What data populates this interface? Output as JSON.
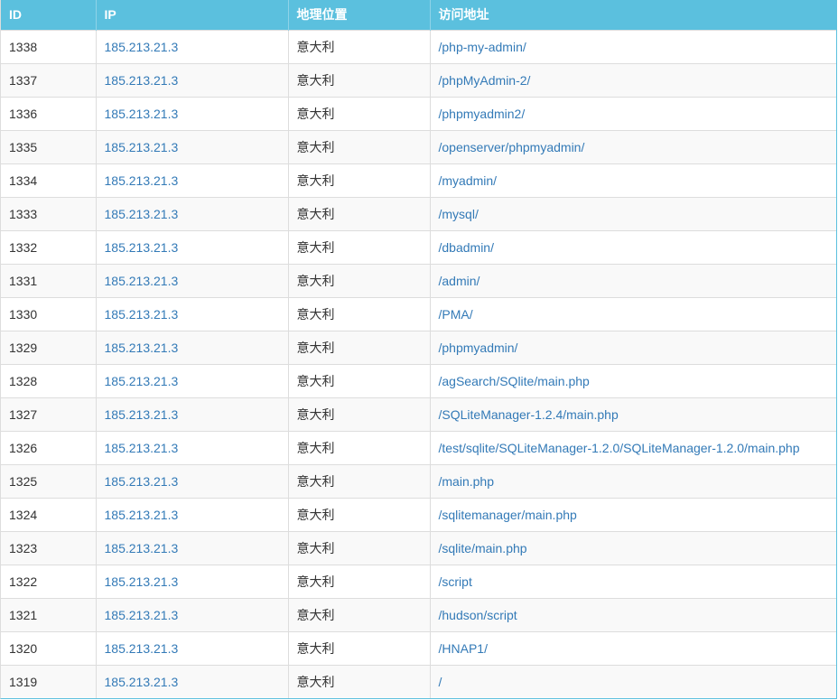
{
  "table": {
    "headers": [
      "ID",
      "IP",
      "地理位置",
      "访问地址"
    ],
    "rows": [
      {
        "id": "1338",
        "ip": "185.213.21.3",
        "geo": "意大利",
        "url": "/php-my-admin/"
      },
      {
        "id": "1337",
        "ip": "185.213.21.3",
        "geo": "意大利",
        "url": "/phpMyAdmin-2/"
      },
      {
        "id": "1336",
        "ip": "185.213.21.3",
        "geo": "意大利",
        "url": "/phpmyadmin2/"
      },
      {
        "id": "1335",
        "ip": "185.213.21.3",
        "geo": "意大利",
        "url": "/openserver/phpmyadmin/"
      },
      {
        "id": "1334",
        "ip": "185.213.21.3",
        "geo": "意大利",
        "url": "/myadmin/"
      },
      {
        "id": "1333",
        "ip": "185.213.21.3",
        "geo": "意大利",
        "url": "/mysql/"
      },
      {
        "id": "1332",
        "ip": "185.213.21.3",
        "geo": "意大利",
        "url": "/dbadmin/"
      },
      {
        "id": "1331",
        "ip": "185.213.21.3",
        "geo": "意大利",
        "url": "/admin/"
      },
      {
        "id": "1330",
        "ip": "185.213.21.3",
        "geo": "意大利",
        "url": "/PMA/"
      },
      {
        "id": "1329",
        "ip": "185.213.21.3",
        "geo": "意大利",
        "url": "/phpmyadmin/"
      },
      {
        "id": "1328",
        "ip": "185.213.21.3",
        "geo": "意大利",
        "url": "/agSearch/SQlite/main.php"
      },
      {
        "id": "1327",
        "ip": "185.213.21.3",
        "geo": "意大利",
        "url": "/SQLiteManager-1.2.4/main.php"
      },
      {
        "id": "1326",
        "ip": "185.213.21.3",
        "geo": "意大利",
        "url": "/test/sqlite/SQLiteManager-1.2.0/SQLiteManager-1.2.0/main.php"
      },
      {
        "id": "1325",
        "ip": "185.213.21.3",
        "geo": "意大利",
        "url": "/main.php"
      },
      {
        "id": "1324",
        "ip": "185.213.21.3",
        "geo": "意大利",
        "url": "/sqlitemanager/main.php"
      },
      {
        "id": "1323",
        "ip": "185.213.21.3",
        "geo": "意大利",
        "url": "/sqlite/main.php"
      },
      {
        "id": "1322",
        "ip": "185.213.21.3",
        "geo": "意大利",
        "url": "/script"
      },
      {
        "id": "1321",
        "ip": "185.213.21.3",
        "geo": "意大利",
        "url": "/hudson/script"
      },
      {
        "id": "1320",
        "ip": "185.213.21.3",
        "geo": "意大利",
        "url": "/HNAP1/"
      },
      {
        "id": "1319",
        "ip": "185.213.21.3",
        "geo": "意大利",
        "url": "/"
      }
    ]
  },
  "colors": {
    "header_bg": "#5bc0de",
    "link": "#337ab7",
    "stripe": "#f9f9f9"
  }
}
